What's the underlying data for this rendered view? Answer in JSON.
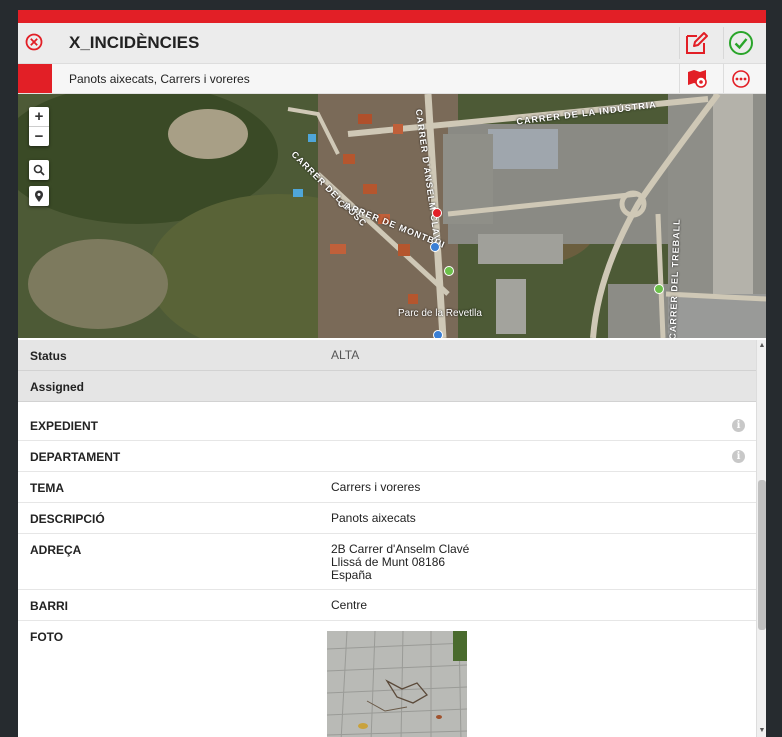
{
  "header": {
    "title": "X_INCIDÈNCIES",
    "subtitle": "Panots aixecats, Carrers i voreres"
  },
  "map": {
    "zoom_in": "+",
    "zoom_out": "−",
    "street_labels": [
      "CARRER DE LA INDÚSTRIA",
      "CARRER D'ANSELM CLAVÉ",
      "CARRER DEL BOSC",
      "CARRER DE MONTBUI",
      "CARRER DEL TREBALL"
    ],
    "place_label": "Parc de la Revetlla"
  },
  "details": {
    "status": {
      "label": "Status",
      "value": "ALTA"
    },
    "assigned": {
      "label": "Assigned"
    },
    "expedient": {
      "label": "EXPEDIENT"
    },
    "departament": {
      "label": "DEPARTAMENT"
    },
    "tema": {
      "label": "TEMA",
      "value": "Carrers i voreres"
    },
    "descripcio": {
      "label": "DESCRIPCIÓ",
      "value": "Panots aixecats"
    },
    "adreca": {
      "label": "ADREÇA",
      "line1": "2B Carrer d'Anselm Clavé",
      "line2": "Llissá de Munt 08186",
      "line3": "España"
    },
    "barri": {
      "label": "BARRI",
      "value": "Centre"
    },
    "foto": {
      "label": "FOTO"
    }
  },
  "colors": {
    "accent_red": "#e21f26",
    "check_green": "#2aa52a"
  },
  "icons": [
    "close-icon",
    "edit-icon",
    "check-icon",
    "map-marker-icon",
    "more-icon",
    "search-icon",
    "location-pin-icon",
    "info-icon"
  ]
}
